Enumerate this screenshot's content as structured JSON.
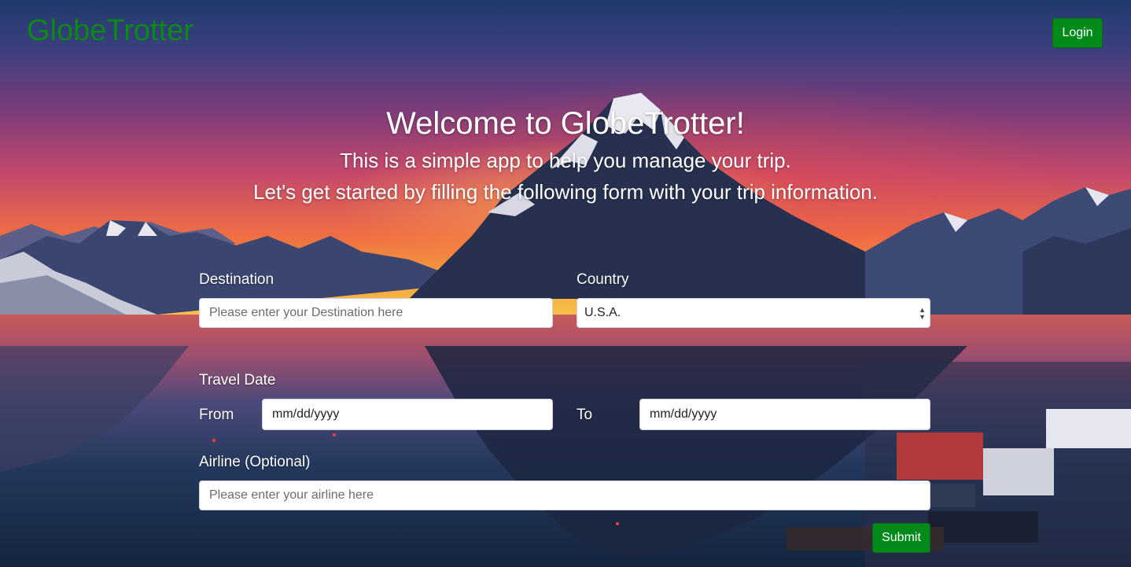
{
  "header": {
    "logo": "GlobeTrotter",
    "login_label": "Login"
  },
  "hero": {
    "title": "Welcome to GlobeTrotter!",
    "subtitle_line1": "This is a simple app to help you manage your trip.",
    "subtitle_line2": "Let's get started by filling the following form with your trip information."
  },
  "form": {
    "destination": {
      "label": "Destination",
      "placeholder": "Please enter your Destination here",
      "value": ""
    },
    "country": {
      "label": "Country",
      "selected": "U.S.A."
    },
    "travel_date": {
      "label": "Travel Date",
      "from_label": "From",
      "from_placeholder": "mm/dd/yyyy",
      "to_label": "To",
      "to_placeholder": "mm/dd/yyyy"
    },
    "airline": {
      "label": "Airline (Optional)",
      "placeholder": "Please enter your airline here",
      "value": ""
    },
    "submit_label": "Submit"
  },
  "colors": {
    "brand_green": "#0a8a14",
    "button_green": "#008a1a"
  }
}
